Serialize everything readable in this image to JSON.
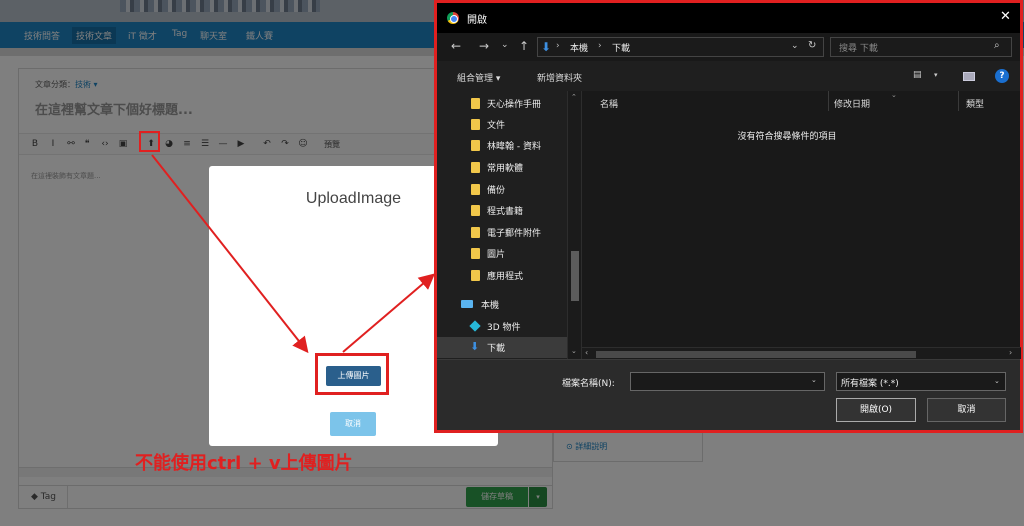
{
  "nav": {
    "items": [
      "技術問答",
      "技術文章",
      "iT 徵才",
      "Tag",
      "聊天室",
      "鐵人賽"
    ]
  },
  "editor": {
    "category_label": "文章分類：",
    "category_value": "技術 ▾",
    "title_placeholder": "在這裡幫文章下個好標題...",
    "content_placeholder": "在這裡裝飾有文章題...",
    "preview_label": "預覽",
    "toolbar_icons": [
      "bold-icon",
      "italic-icon",
      "link-icon",
      "quote-icon",
      "code-icon",
      "image-icon",
      "upload-icon",
      "pie-icon",
      "ordered-list-icon",
      "unordered-list-icon",
      "hr-icon",
      "youtube-icon",
      "undo-icon",
      "redo-icon",
      "emoji-icon"
    ],
    "toolbar_glyphs": [
      "B",
      "I",
      "⚯",
      "❝",
      "‹›",
      "▣",
      "⬆",
      "◕",
      "≡",
      "☰",
      "—",
      "▶",
      "↶",
      "↷",
      "☺"
    ]
  },
  "side": {
    "detail_link": "⊙ 詳細說明"
  },
  "footer": {
    "tag_label": "◆ Tag",
    "save_label": "儲存草稿",
    "save_caret": "▾"
  },
  "upload_modal": {
    "title": "UploadImage",
    "upload_button": "上傳圖片",
    "cancel_button": "取消"
  },
  "annotation": {
    "caption": "不能使用ctrl + v上傳圖片",
    "color": "#e02020"
  },
  "dialog": {
    "title": "開啟",
    "close": "✕",
    "back": "←",
    "forward": "→",
    "recent": "⌄",
    "up": "↑",
    "path": {
      "pc": "本機",
      "downloads": "下載",
      "sep": "›"
    },
    "search_placeholder": "搜尋 下載",
    "organize": "組合管理 ▾",
    "new_folder": "新增資料夾",
    "help": "?",
    "tree": [
      {
        "label": "天心操作手冊",
        "kind": "folder"
      },
      {
        "label": "文件",
        "kind": "folder"
      },
      {
        "label": "林暐翰 - 資料",
        "kind": "folder"
      },
      {
        "label": "常用軟體",
        "kind": "folder"
      },
      {
        "label": "備份",
        "kind": "folder"
      },
      {
        "label": "程式書籍",
        "kind": "folder"
      },
      {
        "label": "電子郵件附件",
        "kind": "folder"
      },
      {
        "label": "圖片",
        "kind": "folder"
      },
      {
        "label": "應用程式",
        "kind": "folder"
      },
      {
        "label": "本機",
        "kind": "pc"
      },
      {
        "label": "3D 物件",
        "kind": "cube"
      },
      {
        "label": "下載",
        "kind": "download"
      }
    ],
    "columns": [
      "名稱",
      "修改日期",
      "類型"
    ],
    "empty_message": "沒有符合搜尋條件的項目",
    "filename_label": "檔案名稱(N):",
    "filename_value": "",
    "filetype_value": "所有檔案 (*.*)",
    "open_button": "開啟(O)",
    "cancel_button": "取消",
    "accent": "#3d8fe0"
  }
}
